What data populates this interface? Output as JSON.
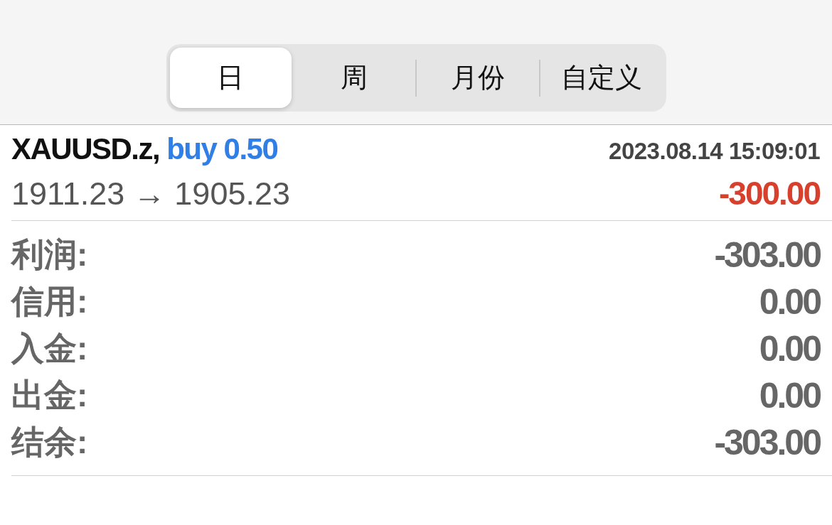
{
  "tabs": [
    {
      "label": "日",
      "selected": true
    },
    {
      "label": "周",
      "selected": false
    },
    {
      "label": "月份",
      "selected": false
    },
    {
      "label": "自定义",
      "selected": false
    }
  ],
  "trade": {
    "symbol": "XAUUSD.z,",
    "order": "buy 0.50",
    "time": "2023.08.14 15:09:01",
    "prices": "1911.23 → 1905.23",
    "profit": "-300.00"
  },
  "summary": [
    {
      "label": "利润:",
      "value": "-303.00"
    },
    {
      "label": "信用:",
      "value": "0.00"
    },
    {
      "label": "入金:",
      "value": "0.00"
    },
    {
      "label": "出金:",
      "value": "0.00"
    },
    {
      "label": "结余:",
      "value": "-303.00"
    }
  ]
}
